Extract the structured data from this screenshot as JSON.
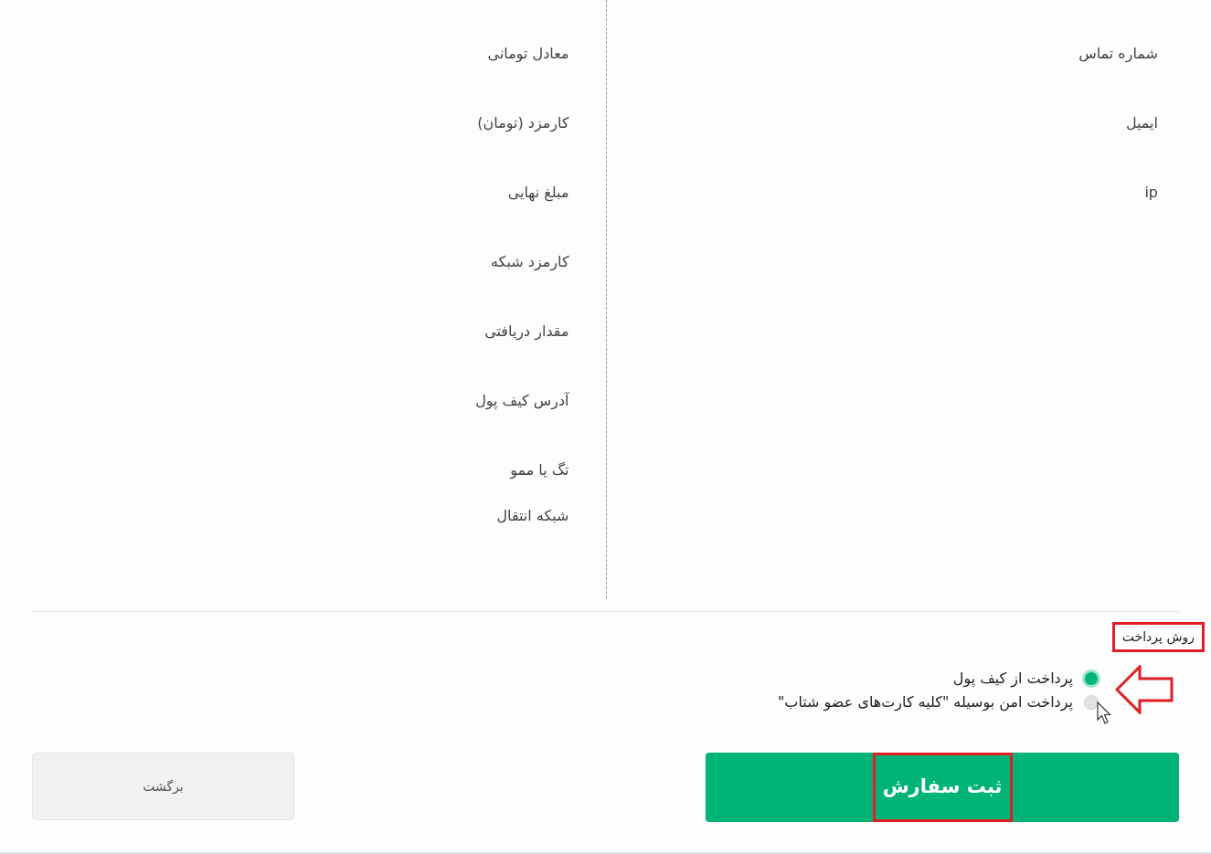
{
  "contact_fields": [
    "شماره تماس",
    "ایمیل",
    "ip"
  ],
  "order_fields": [
    "معادل تومانی",
    "کارمزد (تومان)",
    "مبلغ نهایی",
    "کارمزد شبکه",
    "مقدار دریافتی",
    "آدرس کیف پول",
    "تگ یا ممو",
    "شبکه انتقال"
  ],
  "payment": {
    "title": "روش پرداخت",
    "options": [
      {
        "label": "پرداخت از کیف پول",
        "selected": true
      },
      {
        "label": "پرداخت امن بوسیله \"کلیه کارت‌های عضو شتاب\"",
        "selected": false
      }
    ]
  },
  "buttons": {
    "submit": "ثبت سفارش",
    "back": "برگشت"
  }
}
